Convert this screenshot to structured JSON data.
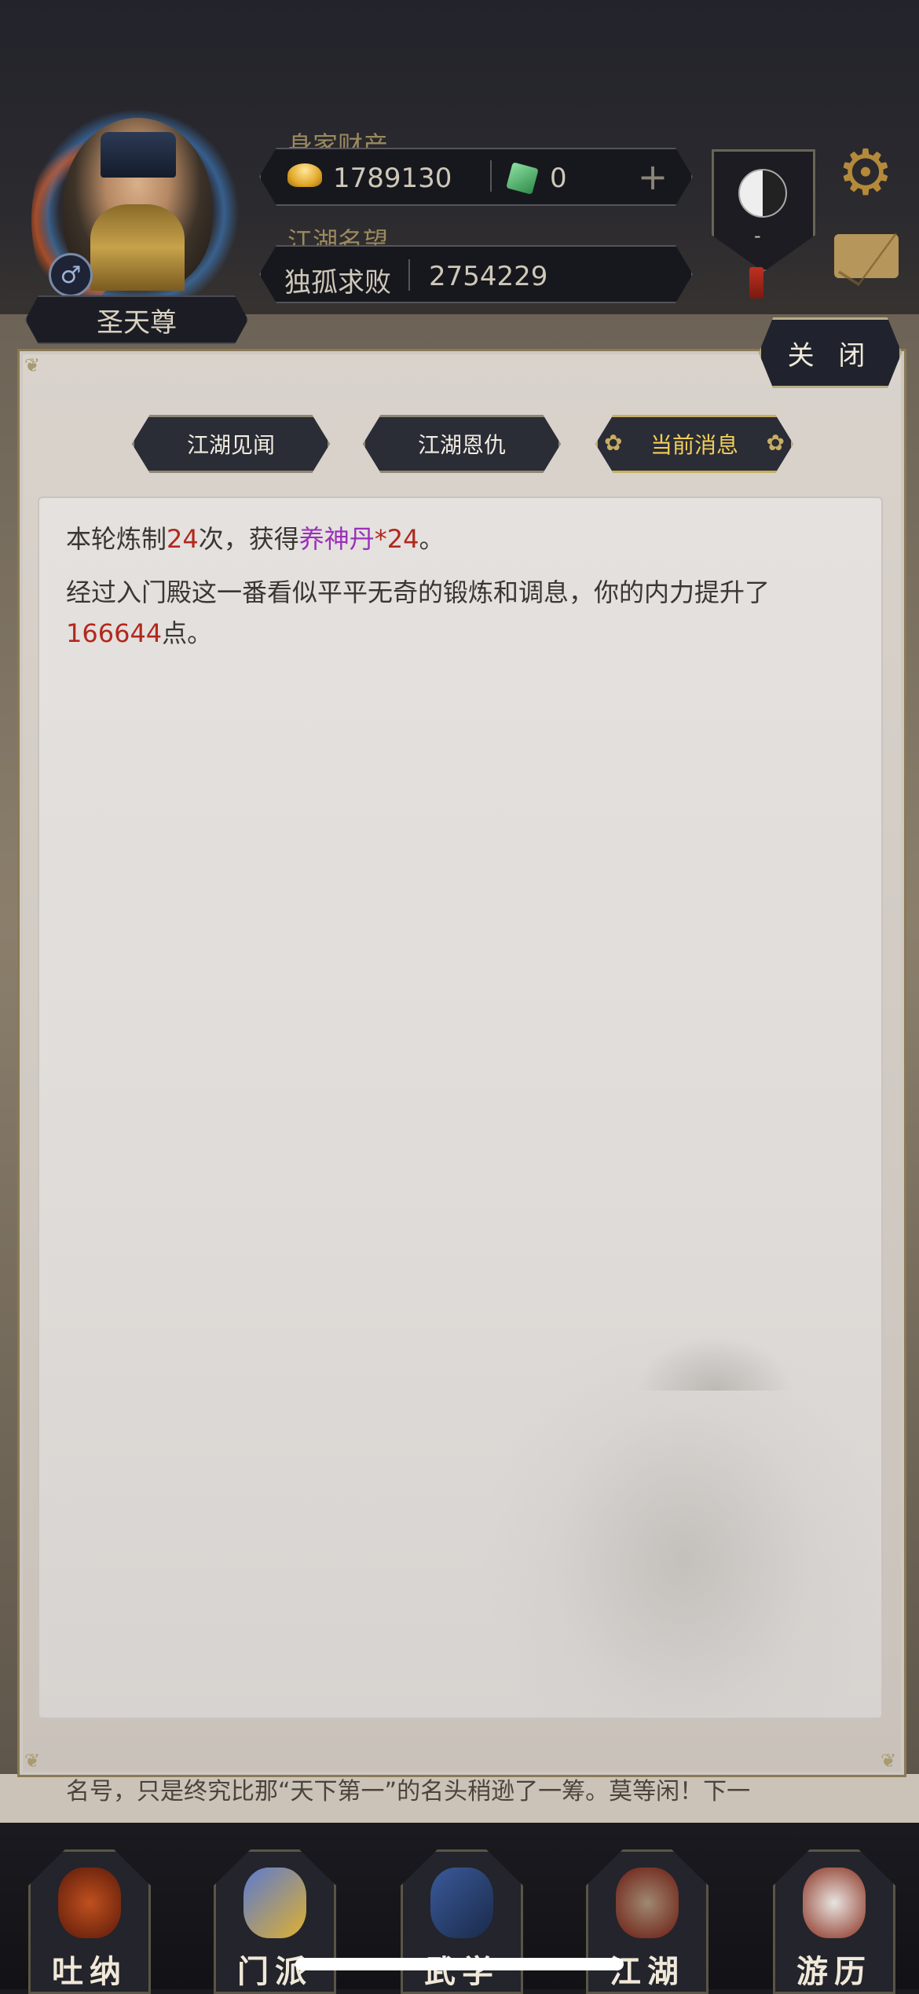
{
  "header": {
    "wealth_label": "身家财产",
    "gold": "1789130",
    "jade": "0",
    "reputation_label": "江湖名望",
    "rank_title": "独孤求败",
    "reputation_value": "2754229",
    "player_name": "圣天尊",
    "gender_symbol": "♂",
    "badge_text": "-"
  },
  "modal": {
    "close_label": "关 闭",
    "tabs": [
      {
        "label": "江湖见闻",
        "active": false
      },
      {
        "label": "江湖恩仇",
        "active": false
      },
      {
        "label": "当前消息",
        "active": true
      }
    ],
    "messages": [
      {
        "p1": "本轮炼制",
        "n1": "24",
        "p2": "次，获得",
        "item": "养神丹",
        "p3": "*",
        "n2": "24",
        "p4": "。"
      },
      {
        "p1": "经过入门殿这一番看似平平无奇的锻炼和调息，你的内力提升了",
        "n1": "166644",
        "p2": "点。"
      }
    ]
  },
  "background_text": "名号，只是终究比那“天下第一”的名头稍逊了一筹。莫等闲！下一",
  "nav": [
    {
      "label": "吐纳"
    },
    {
      "label": "门派"
    },
    {
      "label": "武学"
    },
    {
      "label": "江湖"
    },
    {
      "label": "游历"
    }
  ],
  "colors": {
    "highlight_red": "#b2281c",
    "item_purple": "#9a30b8",
    "active_tab_gold": "#f2cf58"
  },
  "icons": [
    "gold-ingot-icon",
    "jade-ticket-icon",
    "plus-icon",
    "taiji-icon",
    "gear-icon",
    "mail-icon",
    "male-icon"
  ]
}
